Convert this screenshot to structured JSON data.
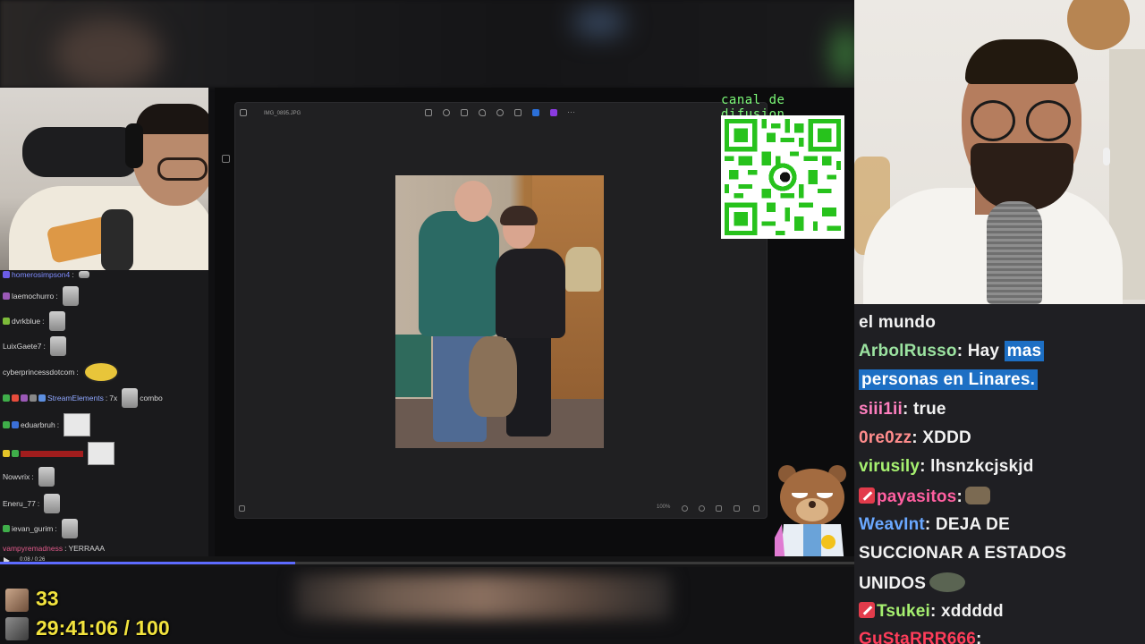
{
  "left_chat": [
    {
      "name": "homerosimpson4",
      "name_color": "#7f8cff",
      "message": "",
      "emote": "sm"
    },
    {
      "name": "laemochurro",
      "name_color": "#c8c8c8",
      "message": "",
      "emote": "sm"
    },
    {
      "name": "dvrkblue",
      "name_color": "#c8c8c8",
      "message": "",
      "emote": "sm"
    },
    {
      "name": "LuixGaete7",
      "name_color": "#c8c8c8",
      "message": "",
      "emote": "sm"
    },
    {
      "name": "cyberprincessdotcom",
      "name_color": "#c8c8c8",
      "message": "",
      "emote": "blob"
    },
    {
      "name": "StreamElements",
      "name_color": "#8fa7ff",
      "message": "7x",
      "suffix": "combo",
      "emote": "sm"
    },
    {
      "name": "eduarbruh",
      "name_color": "#c8c8c8",
      "message": "",
      "emote": "sq"
    },
    {
      "name": "",
      "name_color": "#d22c2c",
      "message": "",
      "emote": "sq"
    },
    {
      "name": "Nowvrix",
      "name_color": "#c8c8c8",
      "message": "",
      "emote": "sm"
    },
    {
      "name": "Eneru_77",
      "name_color": "#c8c8c8",
      "message": "",
      "emote": "sm"
    },
    {
      "name": "ievan_gurim",
      "name_color": "#c8c8c8",
      "message": "",
      "emote": "sm"
    },
    {
      "name": "vampyremadness",
      "name_color": "#e05a8a",
      "message": "YERRAAA",
      "emote": ""
    }
  ],
  "photo_viewer": {
    "filename": "IMG_0895.JPG",
    "zoom": "100%"
  },
  "playback": {
    "time": "0:08 / 0:26",
    "progress": 0.346
  },
  "qr": {
    "label": "canal de difusion"
  },
  "stats": {
    "count": "33",
    "timer": "29:41:06 / 100"
  },
  "right_chat": [
    {
      "name": "",
      "name_color": "#ffffff",
      "message": "el mundo"
    },
    {
      "name": "ArbolRusso",
      "name_color": "#9be2a0",
      "message_plain": " Hay ",
      "message_hl": "mas"
    },
    {
      "name": "",
      "name_color": "#ffffff",
      "message_hl": "personas en Linares."
    },
    {
      "name": "siii1ii",
      "name_color": "#ff7fbf",
      "message": " true"
    },
    {
      "name": "0re0zz",
      "name_color": "#ff8c8c",
      "message": " XDDD"
    },
    {
      "name": "virusily",
      "name_color": "#a6f070",
      "message": " lhsnzkcjskjd"
    },
    {
      "name": "payasitos",
      "name_color": "#ff5fa0",
      "message": "",
      "badge": "sword",
      "emote": "dog"
    },
    {
      "name": "WeavInt",
      "name_color": "#6aa8ff",
      "message": " DEJA DE"
    },
    {
      "name": "",
      "name_color": "#ffffff",
      "message": "SUCCIONAR A ESTADOS"
    },
    {
      "name": "",
      "name_color": "#ffffff",
      "message": "UNIDOS",
      "emote": "frog"
    },
    {
      "name": "Tsukei",
      "name_color": "#a6f070",
      "message": " xddddd",
      "badge": "sword"
    },
    {
      "name": "GuStaRRR666",
      "name_color": "#ff3d5a",
      "message": ""
    }
  ],
  "colors": {
    "accent_blue": "#1d6fc4",
    "qr_green": "#7cfa78",
    "stat_yellow": "#f2e33e",
    "progress": "#5d6bff"
  }
}
